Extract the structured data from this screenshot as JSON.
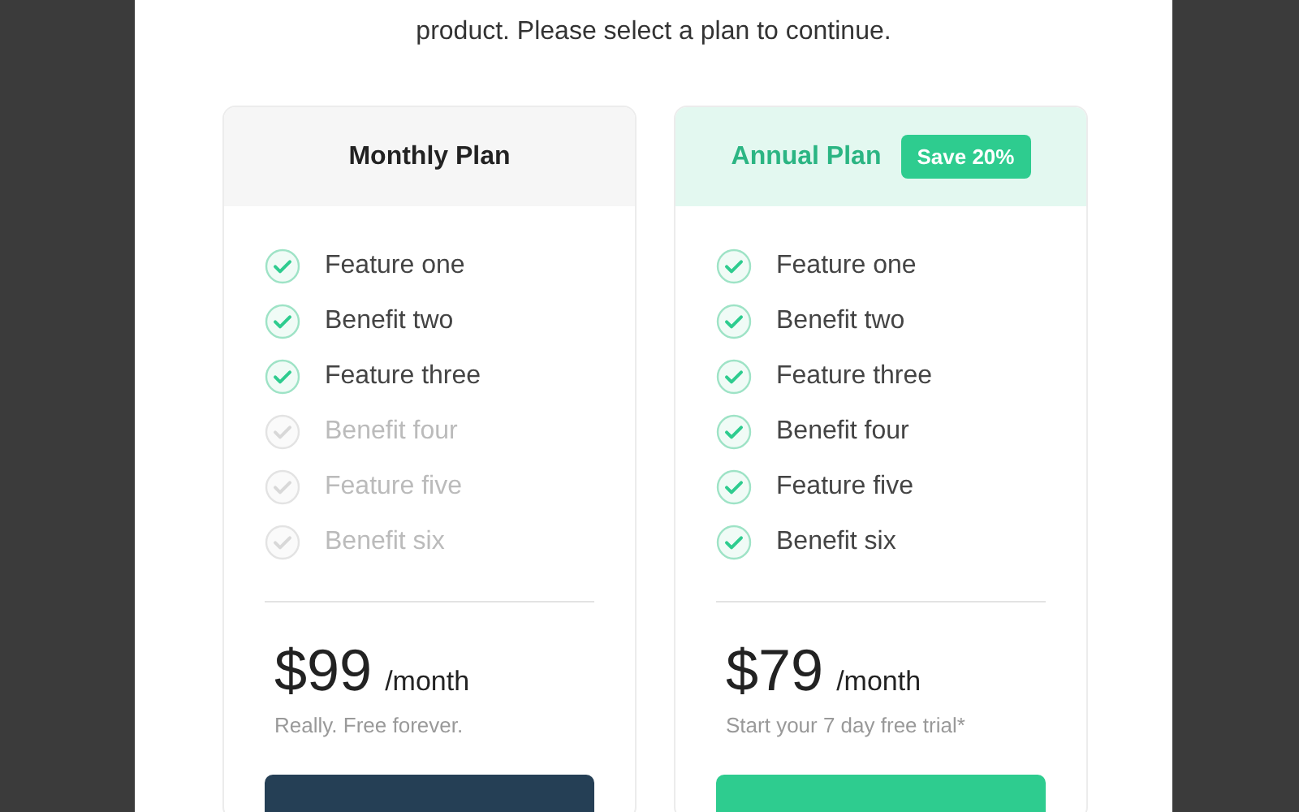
{
  "intro": "product. Please select a plan to continue.",
  "plans": [
    {
      "kind": "basic",
      "title": "Monthly Plan",
      "features": [
        {
          "label": "Feature one",
          "included": true
        },
        {
          "label": "Benefit two",
          "included": true
        },
        {
          "label": "Feature three",
          "included": true
        },
        {
          "label": "Benefit four",
          "included": false
        },
        {
          "label": "Feature five",
          "included": false
        },
        {
          "label": "Benefit six",
          "included": false
        }
      ],
      "price": "$99",
      "period": "/month",
      "note": "Really. Free forever."
    },
    {
      "kind": "featured",
      "title": "Annual Plan",
      "badge": "Save 20%",
      "features": [
        {
          "label": "Feature one",
          "included": true
        },
        {
          "label": "Benefit two",
          "included": true
        },
        {
          "label": "Feature three",
          "included": true
        },
        {
          "label": "Benefit four",
          "included": true
        },
        {
          "label": "Feature five",
          "included": true
        },
        {
          "label": "Benefit six",
          "included": true
        }
      ],
      "price": "$79",
      "period": "/month",
      "note": "Start your 7 day free trial*"
    }
  ]
}
